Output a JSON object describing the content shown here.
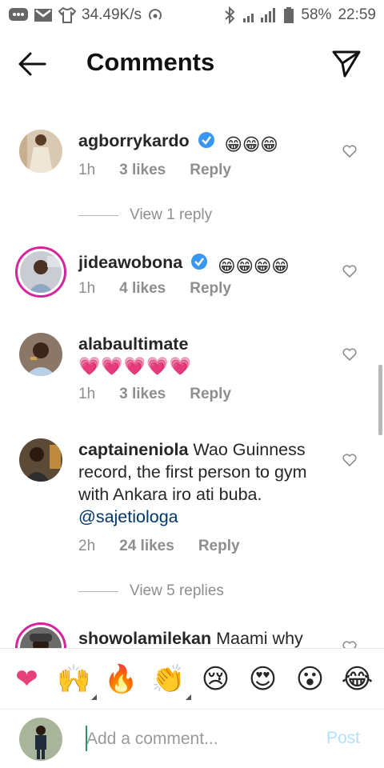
{
  "status_bar": {
    "network_speed": "34.49K/s",
    "battery": "58%",
    "time": "22:59"
  },
  "header": {
    "title": "Comments"
  },
  "comments": [
    {
      "username": "agborrykardo",
      "verified": true,
      "text": "😁😁😁",
      "time": "1h",
      "likes": "3 likes",
      "reply": "Reply",
      "view_replies": "View 1 reply"
    },
    {
      "username": "jideawobona",
      "verified": true,
      "text": "😁😁😁😁",
      "time": "1h",
      "likes": "4 likes",
      "reply": "Reply"
    },
    {
      "username": "alabaultimate",
      "verified": false,
      "text": "💗💗💗💗💗",
      "time": "1h",
      "likes": "3 likes",
      "reply": "Reply"
    },
    {
      "username": "captaineniola",
      "verified": false,
      "text": "Wao Guinness record, the first person to gym with Ankara iro ati buba.",
      "mention": "@sajetiologa",
      "time": "2h",
      "likes": "24 likes",
      "reply": "Reply",
      "view_replies": "View 5 replies"
    },
    {
      "username": "showolamilekan",
      "verified": false,
      "text": "Maami why"
    }
  ],
  "emoji_bar": [
    "❤",
    "🙌",
    "🔥",
    "👏",
    "😢",
    "😍",
    "😮",
    "😂"
  ],
  "composer": {
    "placeholder": "Add a comment...",
    "post_label": "Post"
  },
  "colors": {
    "verified": "#3897f0",
    "heart": "#e8407a",
    "post_disabled": "#b2dffc",
    "story_ring": "#d6249f",
    "mention": "#00376b"
  }
}
